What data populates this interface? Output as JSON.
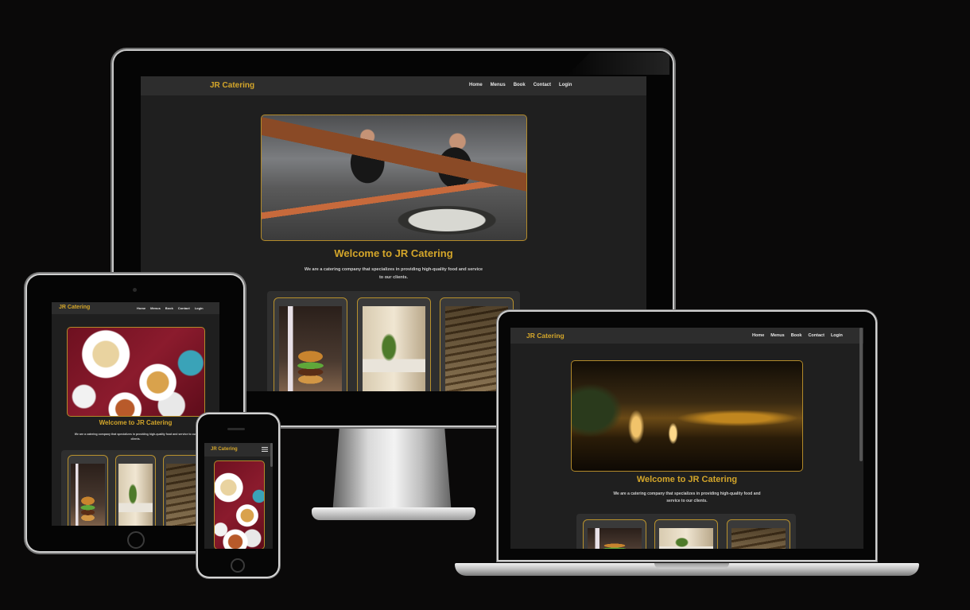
{
  "site": {
    "brand": "JR Catering",
    "nav": [
      "Home",
      "Menus",
      "Book",
      "Contact",
      "Login"
    ],
    "welcome": "Welcome to JR Catering",
    "tagline": "We are a catering company that specializes in providing high-quality food and service to our clients."
  },
  "icons": {
    "menu": "hamburger-menu-icon"
  },
  "colors": {
    "background": "#0a0909",
    "site_background": "#1f1f1f",
    "navbar": "#2d2d2d",
    "accent_gold": "#d4a62a",
    "card_border": "#b8912d"
  }
}
